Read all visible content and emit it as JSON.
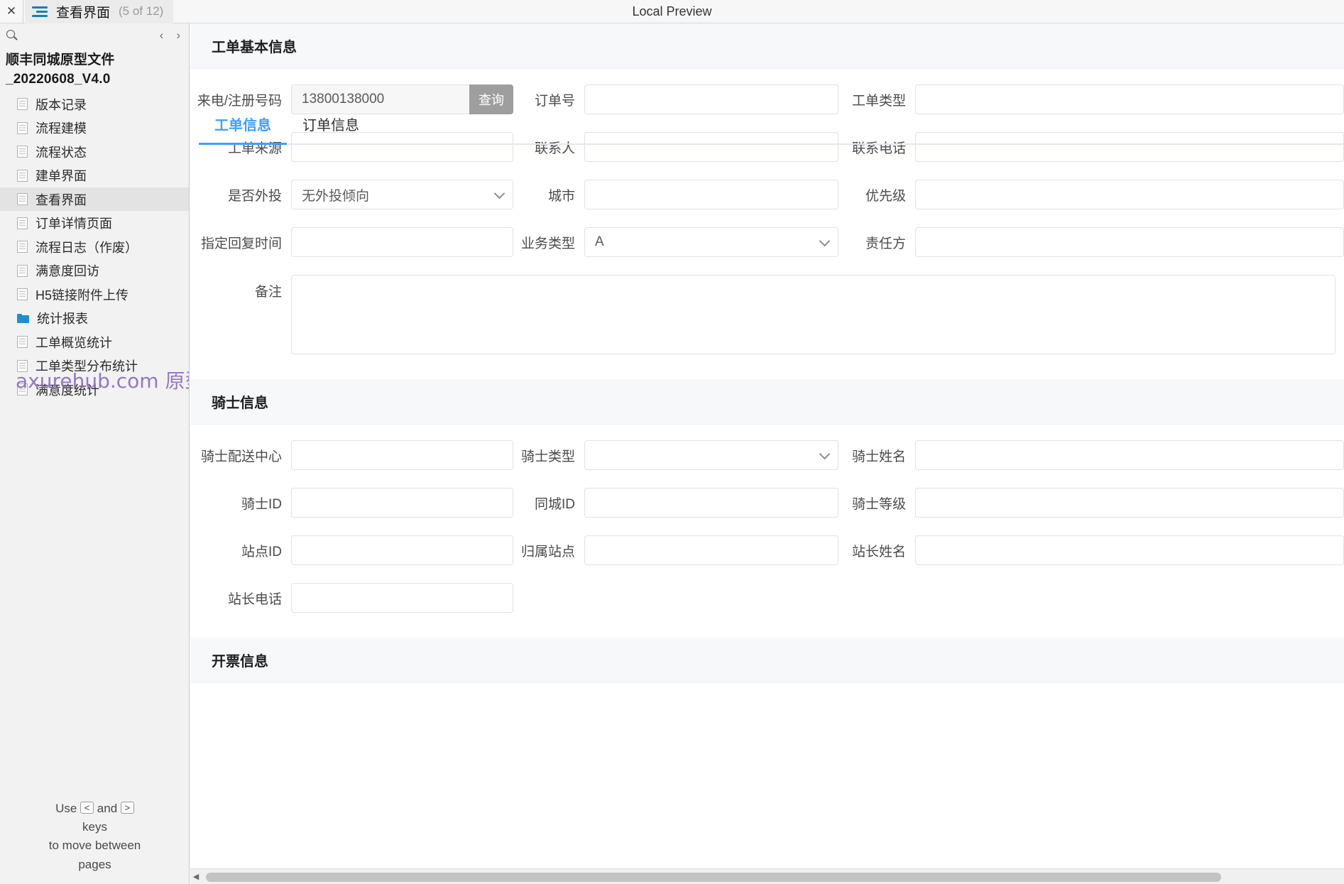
{
  "topbar": {
    "close_icon": "close-icon",
    "menu_icon": "hamburger-icon",
    "page_name": "查看界面",
    "page_counter": "(5 of 12)",
    "preview_title": "Local Preview"
  },
  "sidebar": {
    "search_icon": "search-icon",
    "prev_icon": "‹",
    "next_icon": "›",
    "project_title": "顺丰同城原型文件_20220608_V4.0",
    "items": [
      {
        "label": "版本记录",
        "icon": "page-icon",
        "active": false
      },
      {
        "label": "流程建模",
        "icon": "page-icon",
        "active": false
      },
      {
        "label": "流程状态",
        "icon": "page-icon",
        "active": false
      },
      {
        "label": "建单界面",
        "icon": "page-icon",
        "active": false
      },
      {
        "label": "查看界面",
        "icon": "page-icon",
        "active": true
      },
      {
        "label": "订单详情页面",
        "icon": "page-icon",
        "active": false
      },
      {
        "label": "流程日志（作废）",
        "icon": "page-icon",
        "active": false
      },
      {
        "label": "满意度回访",
        "icon": "page-icon",
        "active": false
      },
      {
        "label": "H5链接附件上传",
        "icon": "page-icon",
        "active": false
      },
      {
        "label": "统计报表",
        "icon": "folder-icon",
        "active": false
      },
      {
        "label": "工单概览统计",
        "icon": "page-icon",
        "active": false
      },
      {
        "label": "工单类型分布统计",
        "icon": "page-icon",
        "active": false
      },
      {
        "label": "满意度统计",
        "icon": "page-icon",
        "active": false
      }
    ],
    "watermark": "axurehub.com 原型资源站",
    "nav_hint": {
      "prefix": "Use",
      "key_prev": "<",
      "middle": "and",
      "key_next": ">",
      "line2": "keys",
      "line3": "to move between",
      "line4": "pages"
    }
  },
  "main": {
    "tabs": [
      {
        "label": "工单信息",
        "active": true
      },
      {
        "label": "订单信息",
        "active": false
      }
    ],
    "sections": [
      {
        "title": "工单基本信息",
        "rows": [
          {
            "fields": [
              {
                "label": "来电/注册号码",
                "type": "input-with-button",
                "value": "13800138000",
                "button": "查询"
              },
              {
                "label": "订单号",
                "type": "input",
                "value": ""
              },
              {
                "label": "工单类型",
                "type": "input",
                "value": ""
              }
            ]
          },
          {
            "fields": [
              {
                "label": "工单来源",
                "type": "input",
                "value": ""
              },
              {
                "label": "联系人",
                "type": "input",
                "value": ""
              },
              {
                "label": "联系电话",
                "type": "input",
                "value": ""
              }
            ]
          },
          {
            "fields": [
              {
                "label": "是否外投",
                "type": "select",
                "value": "无外投倾向"
              },
              {
                "label": "城市",
                "type": "input",
                "value": ""
              },
              {
                "label": "优先级",
                "type": "input",
                "value": ""
              }
            ]
          },
          {
            "fields": [
              {
                "label": "指定回复时间",
                "type": "input",
                "value": ""
              },
              {
                "label": "业务类型",
                "type": "select",
                "value": "A"
              },
              {
                "label": "责任方",
                "type": "input",
                "value": ""
              }
            ]
          },
          {
            "fields": [
              {
                "label": "备注",
                "type": "textarea",
                "value": ""
              }
            ]
          }
        ]
      },
      {
        "title": "骑士信息",
        "rows": [
          {
            "fields": [
              {
                "label": "骑士配送中心",
                "type": "input",
                "value": ""
              },
              {
                "label": "骑士类型",
                "type": "select",
                "value": ""
              },
              {
                "label": "骑士姓名",
                "type": "input",
                "value": ""
              }
            ]
          },
          {
            "fields": [
              {
                "label": "骑士ID",
                "type": "input",
                "value": ""
              },
              {
                "label": "同城ID",
                "type": "input",
                "value": ""
              },
              {
                "label": "骑士等级",
                "type": "input",
                "value": ""
              }
            ]
          },
          {
            "fields": [
              {
                "label": "站点ID",
                "type": "input",
                "value": ""
              },
              {
                "label": "归属站点",
                "type": "input",
                "value": ""
              },
              {
                "label": "站长姓名",
                "type": "input",
                "value": ""
              }
            ]
          },
          {
            "fields": [
              {
                "label": "站长电话",
                "type": "input",
                "value": ""
              }
            ]
          }
        ]
      },
      {
        "title": "开票信息",
        "rows": []
      }
    ]
  },
  "colors": {
    "accent": "#409eff",
    "folder": "#1d8fd1",
    "watermark": "#8d6ec0",
    "query_button": "#9e9e9e"
  }
}
